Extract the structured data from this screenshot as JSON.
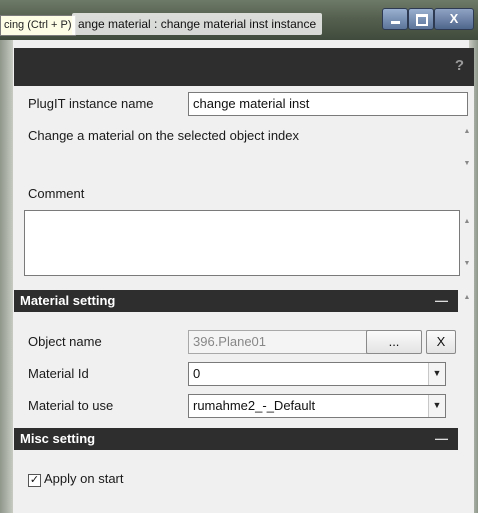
{
  "titlebar": {
    "tooltip": "cing (Ctrl + P)",
    "title": "ange material : change material inst instance",
    "close_label": "X"
  },
  "header": {
    "help_label": "?"
  },
  "plugit": {
    "instance_name_label": "PlugIT instance name",
    "instance_name_value": "change material inst",
    "description": "Change a material on the selected object index",
    "comment_label": "Comment",
    "comment_value": ""
  },
  "material_setting": {
    "title": "Material setting",
    "collapse_label": "—",
    "object_name_label": "Object name",
    "object_name_value": "396.Plane01",
    "browse_label": "...",
    "clear_label": "X",
    "material_id_label": "Material Id",
    "material_id_value": "0",
    "material_use_label": "Material to use",
    "material_use_value": "rumahme2_-_Default"
  },
  "misc_setting": {
    "title": "Misc setting",
    "collapse_label": "—",
    "apply_on_start_label": "Apply on start",
    "apply_on_start_checked": true
  }
}
